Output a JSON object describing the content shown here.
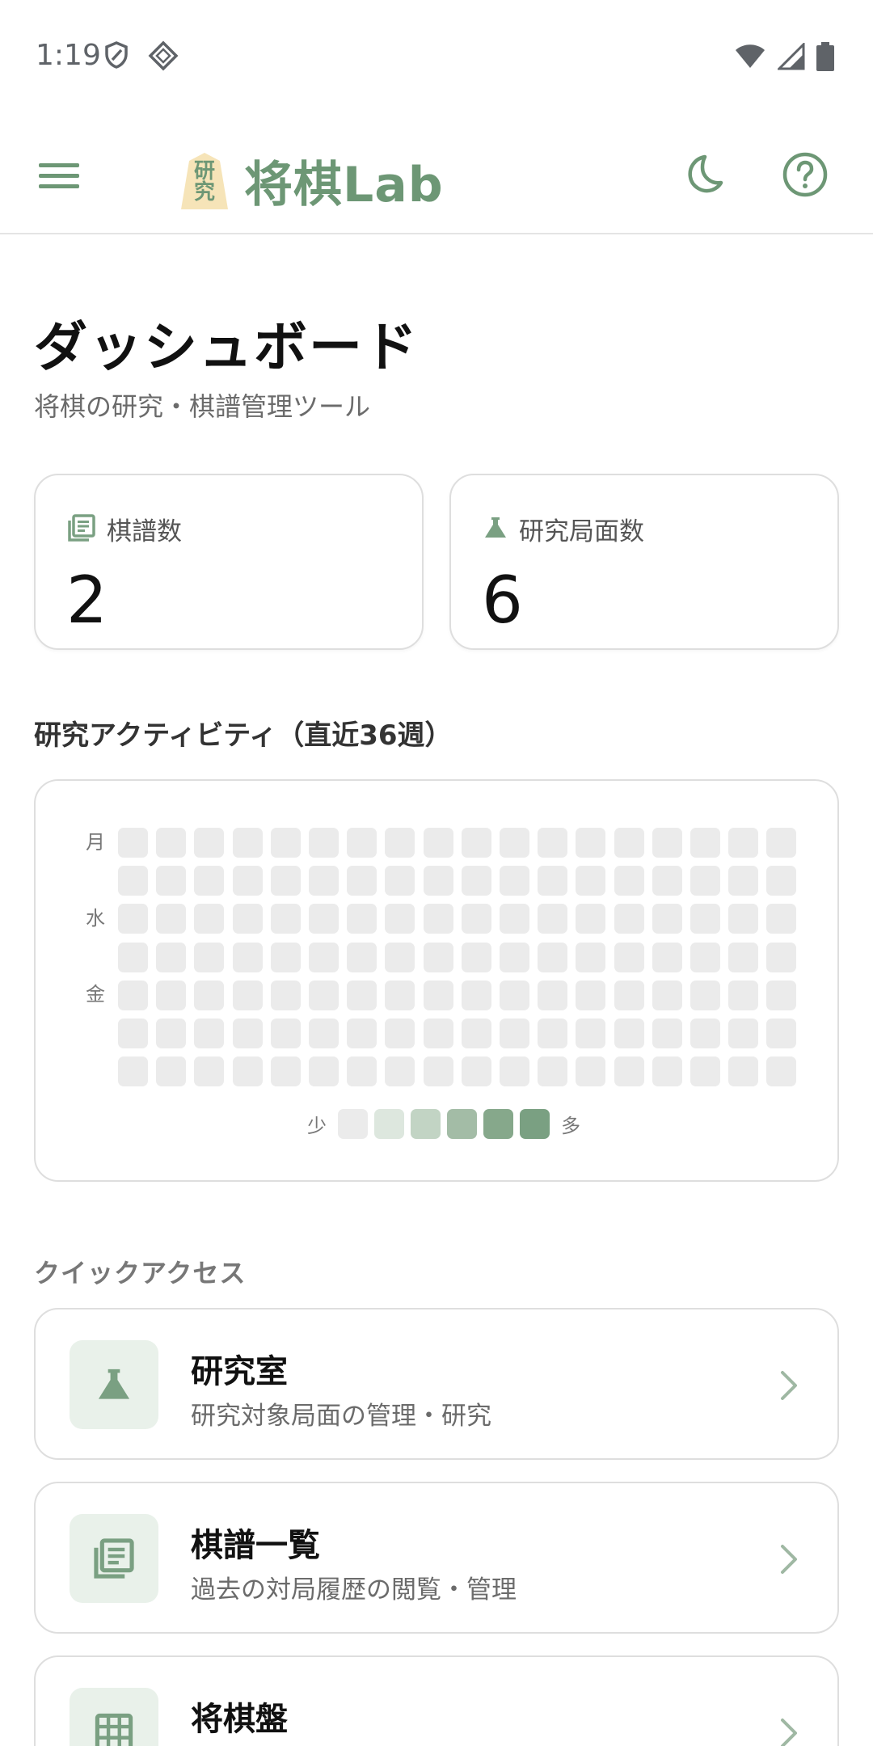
{
  "status_bar": {
    "time": "1:19",
    "icons": [
      "shield-icon",
      "diamond-app-icon",
      "wifi-icon",
      "cell-signal-icon",
      "battery-icon"
    ]
  },
  "app_bar": {
    "logo_piece_text": "研究",
    "app_name": "将棋Lab",
    "icons": [
      "menu-icon",
      "moon-icon",
      "help-icon"
    ]
  },
  "page": {
    "title": "ダッシュボード",
    "subtitle": "将棋の研究・棋譜管理ツール"
  },
  "stats": [
    {
      "label": "棋譜数",
      "value": "2",
      "icon": "kifu-list-icon"
    },
    {
      "label": "研究局面数",
      "value": "6",
      "icon": "flask-icon"
    }
  ],
  "activity": {
    "title": "研究アクティビティ（直近36週）",
    "day_labels": [
      "月",
      "水",
      "金"
    ],
    "legend_less": "少",
    "legend_more": "多",
    "legend_colors": [
      "#ebebeb",
      "#dde7de",
      "#c2d4c4",
      "#a3bca6",
      "#86a88b",
      "#7aa082"
    ],
    "empty_color": "#ebebeb",
    "visible_weeks": 18,
    "days": 7
  },
  "quick_access": {
    "title": "クイックアクセス",
    "items": [
      {
        "title": "研究室",
        "description": "研究対象局面の管理・研究",
        "icon": "flask-icon"
      },
      {
        "title": "棋譜一覧",
        "description": "過去の対局履歴の閲覧・管理",
        "icon": "kifu-list-icon"
      },
      {
        "title": "将棋盤",
        "description": "",
        "icon": "board-grid-icon"
      }
    ]
  },
  "colors": {
    "accent": "#6d9775",
    "accent_light": "#e9f1ea",
    "border": "#dedede"
  }
}
